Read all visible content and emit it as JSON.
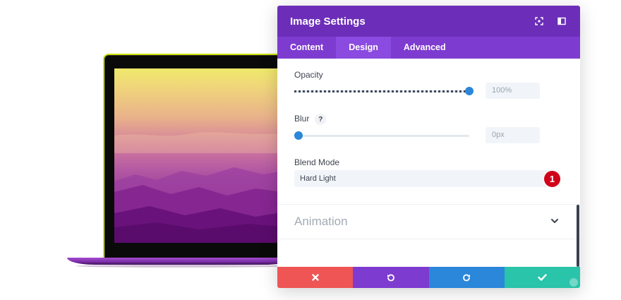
{
  "panel": {
    "title": "Image Settings",
    "tabs": [
      {
        "label": "Content",
        "active": false
      },
      {
        "label": "Design",
        "active": true
      },
      {
        "label": "Advanced",
        "active": false
      }
    ],
    "header_icons": [
      "focus-icon",
      "sidebar-icon"
    ]
  },
  "opacity": {
    "label": "Opacity",
    "value": "100%",
    "fraction": 1.0
  },
  "blur": {
    "label": "Blur",
    "help": "?",
    "value": "0px",
    "fraction": 0.0
  },
  "blend_mode": {
    "label": "Blend Mode",
    "value": "Hard Light",
    "badge": "1"
  },
  "animation": {
    "label": "Animation"
  },
  "footer": {
    "buttons": [
      {
        "name": "cancel",
        "icon": "close-icon",
        "color": "#ef5555"
      },
      {
        "name": "undo",
        "icon": "undo-icon",
        "color": "#7e3bd0"
      },
      {
        "name": "redo",
        "icon": "redo-icon",
        "color": "#2b87da"
      },
      {
        "name": "save",
        "icon": "check-icon",
        "color": "#29c4a9"
      }
    ]
  },
  "colors": {
    "header": "#6c2eb9",
    "tabs": "#7e3bd0",
    "accent": "#2b87da",
    "badge": "#d0021b"
  }
}
